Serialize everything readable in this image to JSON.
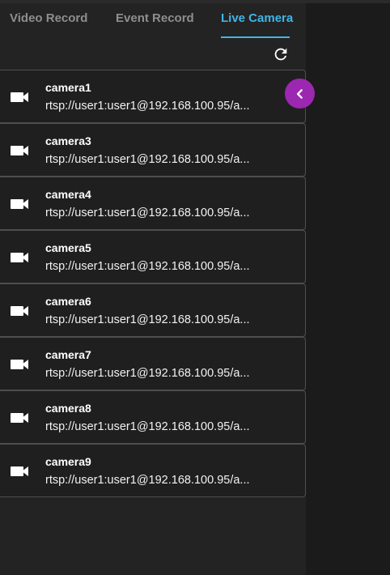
{
  "tabs": [
    {
      "label": "Video Record",
      "active": false
    },
    {
      "label": "Event Record",
      "active": false
    },
    {
      "label": "Live Camera",
      "active": true
    }
  ],
  "accent_color": "#3fb6e8",
  "collapse_button_color": "#9c27b0",
  "refresh_icon": "refresh-icon",
  "collapse_icon": "chevron-left-icon",
  "camera_icon": "videocam-icon",
  "cameras": [
    {
      "name": "camera1",
      "url": "rtsp://user1:user1@192.168.100.95/a..."
    },
    {
      "name": "camera3",
      "url": "rtsp://user1:user1@192.168.100.95/a..."
    },
    {
      "name": "camera4",
      "url": "rtsp://user1:user1@192.168.100.95/a..."
    },
    {
      "name": "camera5",
      "url": "rtsp://user1:user1@192.168.100.95/a..."
    },
    {
      "name": "camera6",
      "url": "rtsp://user1:user1@192.168.100.95/a..."
    },
    {
      "name": "camera7",
      "url": "rtsp://user1:user1@192.168.100.95/a..."
    },
    {
      "name": "camera8",
      "url": "rtsp://user1:user1@192.168.100.95/a..."
    },
    {
      "name": "camera9",
      "url": "rtsp://user1:user1@192.168.100.95/a..."
    }
  ]
}
